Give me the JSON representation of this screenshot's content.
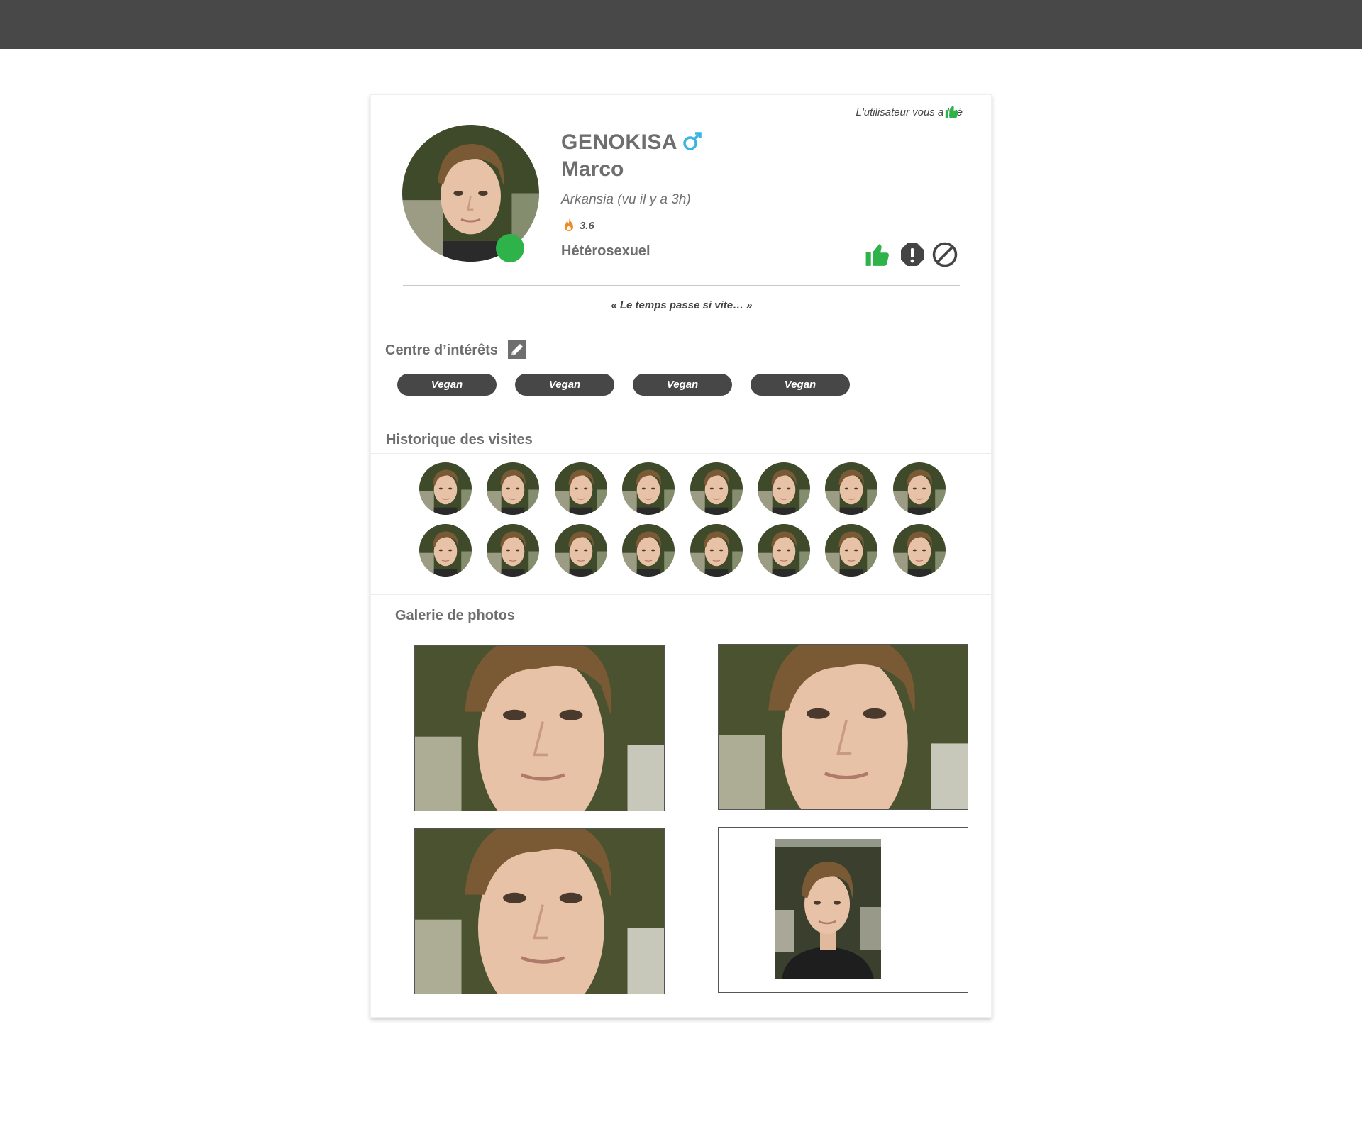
{
  "profile": {
    "liked_note": "L'utilisateur vous a liké",
    "username": "GENOKISA",
    "first_name": "Marco",
    "location": "Arkansia (vu il y a 3h)",
    "score": "3.6",
    "orientation": "Hétérosexuel",
    "bio": "« Le temps passe si vite… »",
    "online": true
  },
  "icons": {
    "liked": "thumbs-up-icon",
    "gender": "male-symbol-icon",
    "score": "flame-icon",
    "like_action": "thumbs-up-icon",
    "report_action": "alert-octagon-icon",
    "block_action": "block-icon",
    "edit": "pencil-icon"
  },
  "colors": {
    "accent_green": "#2db34a",
    "gender_blue": "#3ab4e0",
    "flame_orange": "#f08a24",
    "tag_bg": "#474747",
    "topbar": "#484848"
  },
  "interests": {
    "title": "Centre d’intérêts",
    "tags": [
      "Vegan",
      "Vegan",
      "Vegan",
      "Vegan"
    ]
  },
  "visits": {
    "title": "Historique des visites",
    "count": 16
  },
  "gallery": {
    "title": "Galerie de photos",
    "count": 4
  }
}
